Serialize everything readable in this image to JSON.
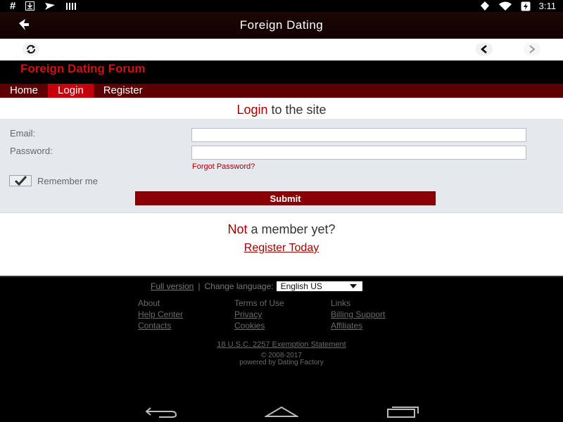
{
  "statusbar": {
    "time": "3:11",
    "left_icons": [
      "hash-icon",
      "download-icon",
      "mail-icon",
      "barcode-icon"
    ],
    "right_icons": [
      "location-icon",
      "wifi-icon",
      "battery-icon"
    ]
  },
  "actionbar": {
    "title": "Foreign Dating"
  },
  "site": {
    "brand": "Foreign Dating Forum",
    "nav": [
      {
        "label": "Home",
        "active": false
      },
      {
        "label": "Login",
        "active": true
      },
      {
        "label": "Register",
        "active": false
      }
    ]
  },
  "login": {
    "heading_accent": "Login",
    "heading_rest": " to the site",
    "email_label": "Email:",
    "email_value": "",
    "password_label": "Password:",
    "password_value": "",
    "forgot_label": "Forgot Password?",
    "remember_label": "Remember me",
    "remember_checked": true,
    "submit_label": "Submit"
  },
  "signup": {
    "accent": "Not",
    "rest": " a member yet?",
    "register_label": "Register Today"
  },
  "footer": {
    "full_version": "Full version",
    "separator": "|",
    "change_language": "Change language:",
    "language_value": "English US",
    "col1": [
      "About",
      "Help Center",
      "Contacts"
    ],
    "col2": [
      "Terms of Use",
      "Privacy",
      "Cookies"
    ],
    "col3": [
      "Links",
      "Billing Support",
      "Affiliates"
    ],
    "statement": "18 U.S.C. 2257 Exemption Statement",
    "copyright": "© 2008-2017",
    "powered": "powered by Dating Factory"
  },
  "colors": {
    "brand_red": "#d40f0f",
    "nav_bg": "#5c0004",
    "nav_active": "#c4000a",
    "submit_bg": "#8a0006",
    "accent_text": "#a40000"
  }
}
